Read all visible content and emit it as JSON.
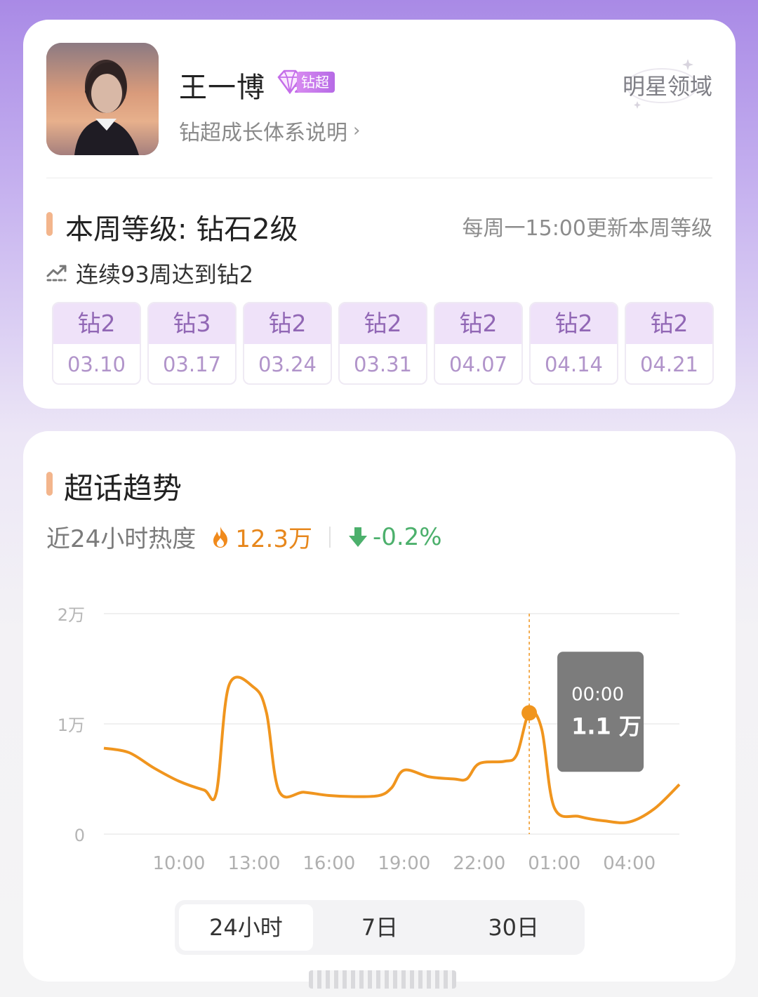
{
  "profile": {
    "name": "王一博",
    "badge_label": "钻超",
    "badge_level": "2",
    "growth_link": "钻超成长体系说明",
    "domain": "明星领域"
  },
  "level": {
    "title": "本周等级: 钻石2级",
    "update_note": "每周一15:00更新本周等级",
    "streak": "连续93周达到钻2",
    "weeks": [
      {
        "level": "钻2",
        "date": "03.10"
      },
      {
        "level": "钻3",
        "date": "03.17"
      },
      {
        "level": "钻2",
        "date": "03.24"
      },
      {
        "level": "钻2",
        "date": "03.31"
      },
      {
        "level": "钻2",
        "date": "04.07"
      },
      {
        "level": "钻2",
        "date": "04.14"
      },
      {
        "level": "钻2",
        "date": "04.21"
      }
    ]
  },
  "trend": {
    "title": "超话趋势",
    "heat_label": "近24小时热度",
    "heat_value": "12.3万",
    "heat_change": "-0.2%",
    "colors": {
      "line": "#f0951e",
      "up": "#e7871c",
      "down": "#4cb06c"
    }
  },
  "chart_data": {
    "type": "line",
    "y_tick_labels": [
      "0",
      "1万",
      "2万"
    ],
    "ylim": [
      0,
      20000
    ],
    "x_tick_labels": [
      "10:00",
      "13:00",
      "16:00",
      "19:00",
      "22:00",
      "01:00",
      "04:00"
    ],
    "series": [
      {
        "x": [
          7,
          8,
          9,
          10,
          11,
          11.5,
          12,
          13,
          13.5,
          14,
          15,
          16,
          17,
          18,
          18.5,
          19,
          20,
          21,
          21.5,
          22,
          23,
          23.5,
          24,
          24.5,
          25,
          26,
          27,
          28,
          29,
          30
        ],
        "values": [
          7800,
          7400,
          6000,
          4800,
          4000,
          3800,
          13500,
          13300,
          11000,
          3900,
          3800,
          3500,
          3400,
          3500,
          4200,
          5800,
          5200,
          5000,
          5000,
          6400,
          6600,
          7200,
          11000,
          9500,
          2400,
          1600,
          1200,
          1100,
          2300,
          4500
        ]
      }
    ],
    "tooltip": {
      "time": "00:00",
      "value": "1.1 万"
    }
  },
  "range_tabs": [
    "24小时",
    "7日",
    "30日"
  ],
  "active_range": "24小时"
}
